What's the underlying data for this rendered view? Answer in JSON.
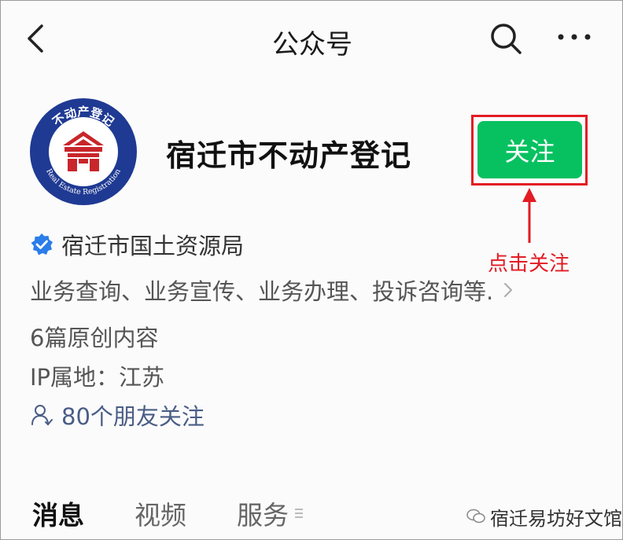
{
  "nav": {
    "title": "公众号"
  },
  "account": {
    "name": "宿迁市不动产登记",
    "logo": {
      "arc_text_top": "不动产登记",
      "arc_text_bottom": "Real Estate Registration"
    },
    "follow_label": "关注",
    "verified_by": "宿迁市国土资源局",
    "description": "业务查询、业务宣传、业务办理、投诉咨询等.",
    "articles": "6篇原创内容",
    "ip_location": "IP属地：江苏",
    "friends_following": "80个朋友关注"
  },
  "annotation": {
    "text": "点击关注",
    "color": "#e31b23"
  },
  "tabs": [
    {
      "label": "消息",
      "active": true
    },
    {
      "label": "视频",
      "active": false
    },
    {
      "label": "服务",
      "active": false
    }
  ],
  "watermark": {
    "text": "宿迁易坊好文馆"
  },
  "colors": {
    "accent_green": "#07c160",
    "highlight_red": "#e31b23",
    "verify_blue": "#2b7de9",
    "friends_text": "#4a5d86"
  },
  "icons": {
    "back": "chevron-left-icon",
    "search": "search-icon",
    "more": "more-icon",
    "verified": "verified-badge-icon",
    "friends": "person-icon",
    "description_more": "chevron-right-icon",
    "service_menu": "menu-icon"
  }
}
